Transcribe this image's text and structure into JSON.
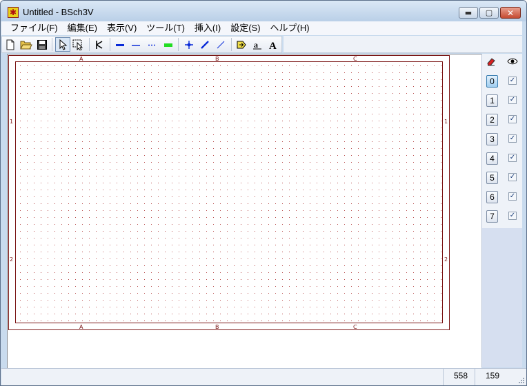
{
  "window": {
    "title": "Untitled - BSch3V"
  },
  "menu": [
    "ファイル(F)",
    "編集(E)",
    "表示(V)",
    "ツール(T)",
    "挿入(I)",
    "設定(S)",
    "ヘルプ(H)"
  ],
  "toolbar": {
    "tools": [
      "new-file-icon",
      "open-folder-icon",
      "save-icon",
      "select-arrow-icon",
      "drag-select-icon",
      "component-icon",
      "wire-icon",
      "bus-icon",
      "dash-line-icon",
      "bus-entry-icon",
      "junction-icon",
      "entry-line-icon",
      "entry-line-thin-icon",
      "tag-icon",
      "label-icon",
      "comment-icon"
    ],
    "accent_colors": {
      "wire": "#0a2bd8",
      "bus": "#22dd22"
    }
  },
  "sheet": {
    "col_labels": [
      "A",
      "B",
      "C"
    ],
    "row_labels": [
      "1",
      "2"
    ],
    "border_color": "#7a1414",
    "grid_color": "#b84a4a"
  },
  "layers": {
    "header_icons": [
      "eraser-icon",
      "eye-icon"
    ],
    "items": [
      {
        "label": "0",
        "visible": true,
        "active": true
      },
      {
        "label": "1",
        "visible": true,
        "active": false
      },
      {
        "label": "2",
        "visible": true,
        "active": false
      },
      {
        "label": "3",
        "visible": true,
        "active": false
      },
      {
        "label": "4",
        "visible": true,
        "active": false
      },
      {
        "label": "5",
        "visible": true,
        "active": false
      },
      {
        "label": "6",
        "visible": true,
        "active": false
      },
      {
        "label": "7",
        "visible": true,
        "active": false
      }
    ]
  },
  "status": {
    "x": "558",
    "y": "159"
  }
}
